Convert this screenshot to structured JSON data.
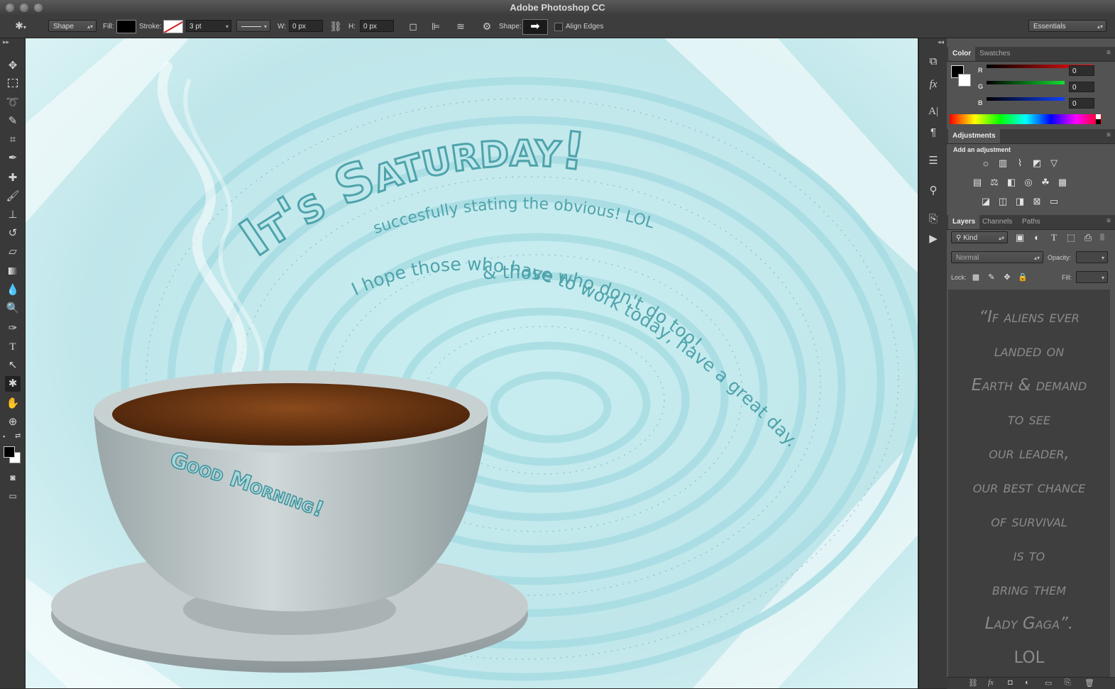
{
  "window": {
    "title": "Adobe Photoshop CC"
  },
  "options_bar": {
    "mode": "Shape",
    "fill_label": "Fill:",
    "stroke_label": "Stroke:",
    "stroke_width": "3 pt",
    "w_label": "W:",
    "w_value": "0 px",
    "h_label": "H:",
    "h_value": "0 px",
    "shape_label": "Shape:",
    "align_edges_label": "Align Edges",
    "workspace": "Essentials"
  },
  "toolbar": {
    "tools": [
      "move-tool",
      "marquee-tool",
      "lasso-tool",
      "quick-selection-tool",
      "crop-tool",
      "eyedropper-tool",
      "healing-brush-tool",
      "brush-tool",
      "clone-stamp-tool",
      "history-brush-tool",
      "eraser-tool",
      "gradient-tool",
      "blur-tool",
      "dodge-tool",
      "pen-tool",
      "type-tool",
      "path-selection-tool",
      "custom-shape-tool",
      "hand-tool",
      "zoom-tool"
    ],
    "active_tool": "custom-shape-tool"
  },
  "canvas": {
    "headline": "It's Saturday!",
    "subline": "succesfully stating the obvious! LOL",
    "message_line1": "I hope those who have to work today, have a great day.",
    "message_line2": "& those who don't do too!",
    "cup_text": "Good Morning!"
  },
  "color_panel": {
    "tabs": [
      "Color",
      "Swatches"
    ],
    "active_tab": "Color",
    "channels": [
      {
        "label": "R",
        "value": "0",
        "color": "#e02020"
      },
      {
        "label": "G",
        "value": "0",
        "color": "#20c040"
      },
      {
        "label": "B",
        "value": "0",
        "color": "#2050e0"
      }
    ]
  },
  "adjustments_panel": {
    "tab": "Adjustments",
    "heading": "Add an adjustment"
  },
  "layers_panel": {
    "tabs": [
      "Layers",
      "Channels",
      "Paths"
    ],
    "active_tab": "Layers",
    "filter_kind": "Kind",
    "blend_mode": "Normal",
    "opacity_label": "Opacity:",
    "lock_label": "Lock:",
    "fill_label": "Fill:",
    "quote_lines": [
      "“If aliens ever",
      "landed on",
      "Earth & demand",
      "to see",
      "our leader,",
      "our best chance",
      "of survival",
      "is to",
      "bring them",
      "Lady Gaga”.",
      "LOL"
    ]
  },
  "colors": {
    "canvas_base": "#d9f2f4",
    "text_teal": "#4fa3ab",
    "coffee": "#6b3310",
    "cup": "#b8c4c6"
  }
}
